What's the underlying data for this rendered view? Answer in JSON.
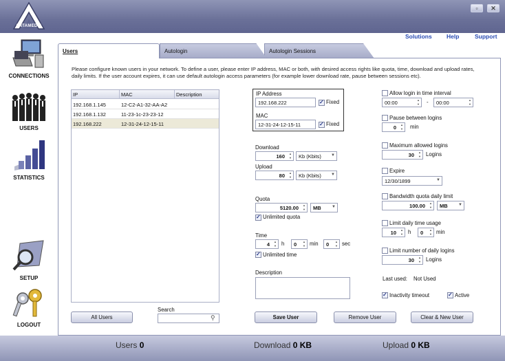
{
  "app": {
    "logo_text": "ANTAMEDIA"
  },
  "window_buttons": [
    "restore-icon",
    "close-icon"
  ],
  "sidebar": {
    "items": [
      {
        "label": "CONNECTIONS",
        "icon": "computer-icon"
      },
      {
        "label": "USERS",
        "icon": "people-icon"
      },
      {
        "label": "STATISTICS",
        "icon": "bar-chart-icon"
      },
      {
        "label": "SETUP",
        "icon": "magnifier-icon"
      },
      {
        "label": "LOGOUT",
        "icon": "keys-icon"
      }
    ]
  },
  "header_links": [
    "Solutions",
    "Help",
    "Support"
  ],
  "tabs": [
    {
      "label": "Users",
      "active": true
    },
    {
      "label": "Autologin",
      "active": false
    },
    {
      "label": "Autologin Sessions",
      "active": false
    }
  ],
  "intro": "Please configure known users in your network. To define a user, please enter IP address, MAC or both, with desired access rights like quota, time, download and upload rates, daily limits. If the user account expires, it can use default autologin access parameters (for example lower download rate, pause between sessions etc).",
  "table": {
    "columns": [
      "IP",
      "MAC",
      "Description"
    ],
    "rows": [
      {
        "ip": "192.168.1.145",
        "mac": "12-C2-A1-32-AA-A2",
        "description": ""
      },
      {
        "ip": "192.168.1.132",
        "mac": "11-23-1c-23-23-12",
        "description": ""
      },
      {
        "ip": "192.168.222",
        "mac": "12-31-24-12-15-11",
        "description": "",
        "selected": true
      }
    ]
  },
  "all_users_label": "All Users",
  "search": {
    "label": "Search",
    "value": ""
  },
  "form": {
    "ip_label": "IP Address",
    "ip_value": "192.168.222",
    "ip_fixed_label": "Fixed",
    "mac_label": "MAC",
    "mac_value": "12-31-24-12-15-11",
    "mac_fixed_label": "Fixed",
    "download_label": "Download",
    "download_value": "160",
    "download_unit": "Kb (Kbits)",
    "upload_label": "Upload",
    "upload_value": "80",
    "upload_unit": "Kb (Kbits)",
    "quota_label": "Quota",
    "quota_value": "5120.00",
    "quota_unit": "MB",
    "unlimited_quota_label": "Unlimited quota",
    "time_label": "Time",
    "time_h": "4",
    "time_h_unit": "h",
    "time_min": "0",
    "time_min_unit": "min",
    "time_sec": "0",
    "time_sec_unit": "sec",
    "unlimited_time_label": "Unlimited time",
    "description_label": "Description",
    "description_value": ""
  },
  "limits": {
    "allow_login_label": "Allow login in time interval",
    "allow_from": "00:00",
    "allow_sep": "-",
    "allow_to": "00:00",
    "pause_label": "Pause between logins",
    "pause_value": "0",
    "pause_unit": "min",
    "max_logins_label": "Maximum allowed logins",
    "max_logins_value": "30",
    "max_logins_unit": "Logins",
    "expire_label": "Expire",
    "expire_value": "12/30/1899",
    "bandwidth_label": "Bandwidth quota daily limit",
    "bandwidth_value": "100.00",
    "bandwidth_unit": "MB",
    "daily_time_label": "Limit daily time usage",
    "daily_time_h": "10",
    "daily_time_h_unit": "h",
    "daily_time_min": "0",
    "daily_time_min_unit": "min",
    "daily_logins_label": "Limit number of daily logins",
    "daily_logins_value": "30",
    "daily_logins_unit": "Logins",
    "last_used_label": "Last used:",
    "last_used_value": "Not Used",
    "inactivity_label": "Inactivity timeout",
    "active_label": "Active"
  },
  "buttons": {
    "save": "Save User",
    "remove": "Remove User",
    "clear": "Clear & New User"
  },
  "status": {
    "users_label": "Users",
    "users_value": "0",
    "download_label": "Download",
    "download_value": "0 KB",
    "upload_label": "Upload",
    "upload_value": "0 KB"
  }
}
